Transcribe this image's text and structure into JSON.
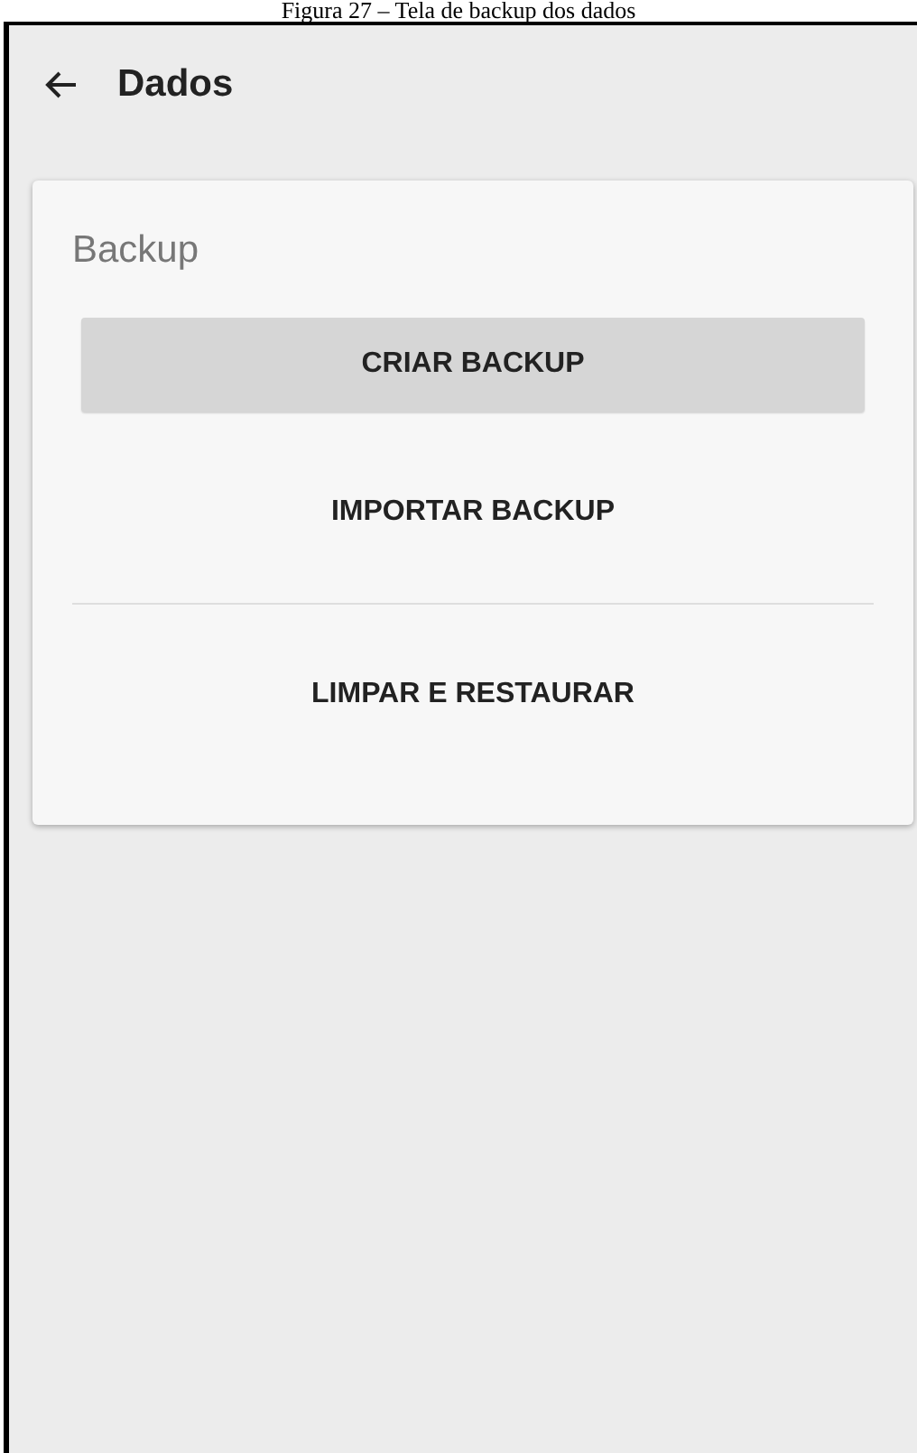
{
  "caption": "Figura 27 – Tela de backup dos dados",
  "app_bar": {
    "title": "Dados"
  },
  "card": {
    "title": "Backup",
    "items": [
      {
        "kind": "raised",
        "label": "CRIAR BACKUP"
      },
      {
        "kind": "flat",
        "label": "IMPORTAR BACKUP"
      },
      {
        "kind": "divider"
      },
      {
        "kind": "flat",
        "label": "LIMPAR E RESTAURAR"
      }
    ]
  }
}
